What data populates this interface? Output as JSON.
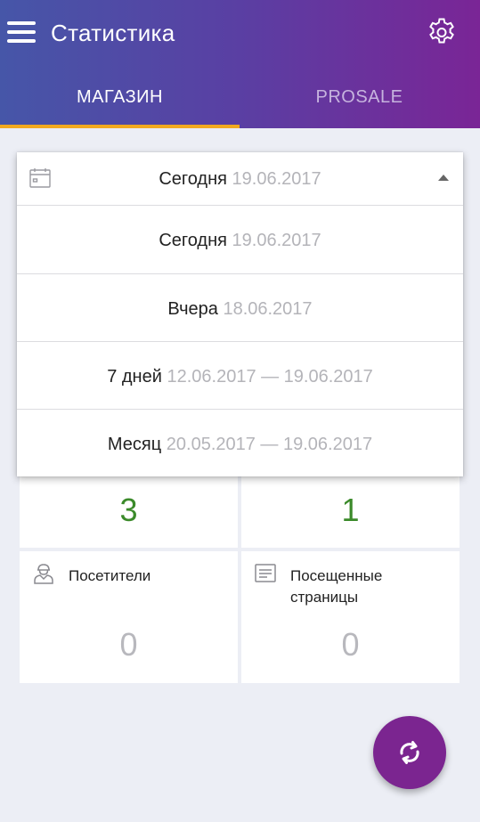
{
  "header": {
    "title": "Статистика",
    "menu_icon": "menu-icon",
    "settings_icon": "gear-icon"
  },
  "tabs": [
    {
      "label": "МАГАЗИН",
      "active": true
    },
    {
      "label": "PROSALE",
      "active": false
    }
  ],
  "colors": {
    "header_gradient_start": "#4656a8",
    "header_gradient_end": "#7a2596",
    "tab_indicator": "#f2a91f",
    "stat_positive": "#3b8a2a",
    "stat_zero": "#b8b8bd",
    "fab": "#7b2590"
  },
  "period_dropdown": {
    "selected": {
      "label": "Сегодня",
      "date": "19.06.2017"
    },
    "options": [
      {
        "label": "Сегодня",
        "date": "19.06.2017"
      },
      {
        "label": "Вчера",
        "date": "18.06.2017"
      },
      {
        "label": "7 дней",
        "date": "12.06.2017 — 19.06.2017"
      },
      {
        "label": "Месяц",
        "date": "20.05.2017 — 19.06.2017"
      }
    ]
  },
  "stats": {
    "top_left_value": "3",
    "top_right_value": "1",
    "visitors": {
      "label": "Посетители",
      "value": "0",
      "icon": "visitor-icon"
    },
    "pages": {
      "label": "Посещенные страницы",
      "value": "0",
      "icon": "document-icon"
    }
  },
  "fab": {
    "icon": "refresh-icon"
  }
}
